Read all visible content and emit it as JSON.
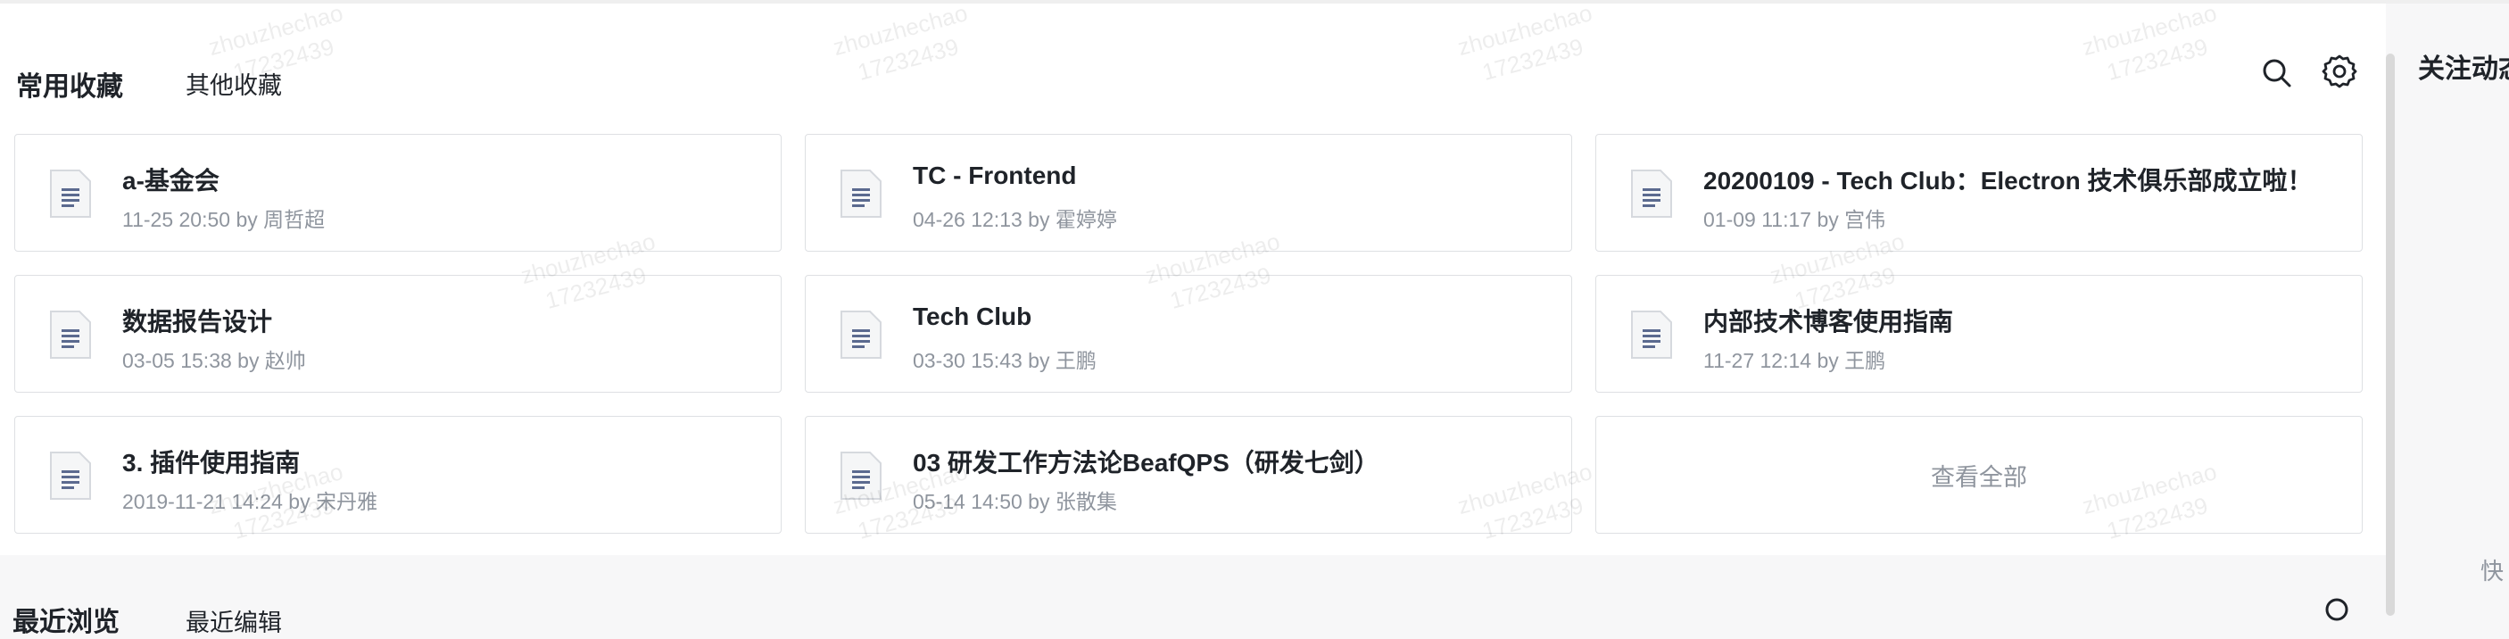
{
  "favorites": {
    "tabs": {
      "active": "常用收藏",
      "other": "其他收藏"
    },
    "icons": {
      "search": "search-icon",
      "settings": "gear-icon",
      "document": "document-icon"
    },
    "cards": [
      {
        "title": "a-基金会",
        "meta": "11-25 20:50 by 周哲超"
      },
      {
        "title": "TC - Frontend",
        "meta": "04-26 12:13 by 霍婷婷"
      },
      {
        "title": "20200109 - Tech Club：Electron 技术俱乐部成立啦！",
        "meta": "01-09 11:17 by 宫伟"
      },
      {
        "title": "数据报告设计",
        "meta": "03-05 15:38 by 赵帅"
      },
      {
        "title": "Tech Club",
        "meta": "03-30 15:43 by 王鹏"
      },
      {
        "title": "内部技术博客使用指南",
        "meta": "11-27 12:14 by 王鹏"
      },
      {
        "title": "3. 插件使用指南",
        "meta": "2019-11-21 14:24 by 宋丹雅"
      },
      {
        "title": "03 研发工作方法论BeafQPS（研发七剑）",
        "meta": "05-14 14:50 by 张散集"
      }
    ],
    "view_all": "查看全部"
  },
  "right_panel": {
    "title": "关注动态",
    "quick": "快"
  },
  "recent": {
    "active": "最近浏览",
    "other": "最近编辑"
  },
  "watermark": {
    "name": "zhouzhechao",
    "id": "17232439"
  },
  "colors": {
    "border": "#dee0e3",
    "meta_text": "#8f959e",
    "title_text": "#1f2329",
    "doc_icon": "#5b6a8f"
  }
}
